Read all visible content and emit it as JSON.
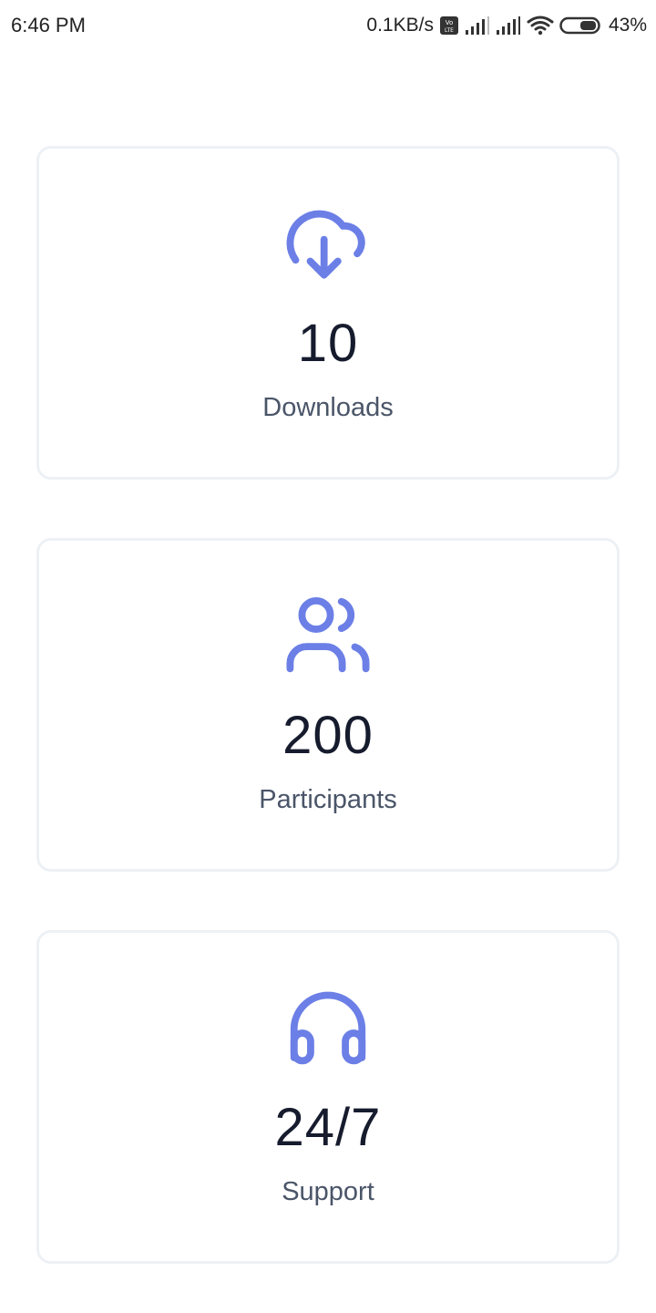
{
  "status_bar": {
    "time": "6:46 PM",
    "net_speed": "0.1KB/s",
    "volte_badge": "Vo LTE",
    "battery_percent": "43%",
    "icons": [
      "volte-icon",
      "signal-icon",
      "signal-icon",
      "wifi-icon",
      "battery-icon"
    ]
  },
  "accent_color": "#6b7fe6",
  "cards": [
    {
      "icon": "cloud-download-icon",
      "value": "10",
      "label": "Downloads"
    },
    {
      "icon": "users-icon",
      "value": "200",
      "label": "Participants"
    },
    {
      "icon": "headphones-icon",
      "value": "24/7",
      "label": "Support"
    }
  ]
}
